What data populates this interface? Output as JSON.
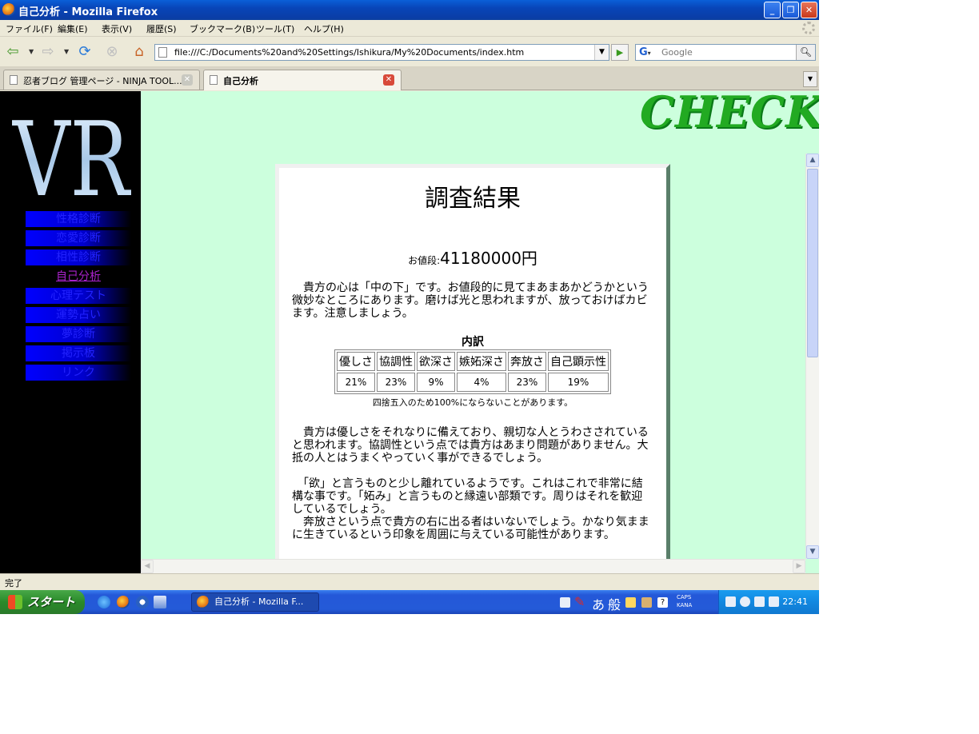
{
  "window": {
    "title": "自己分析 - Mozilla Firefox"
  },
  "menu": {
    "items": [
      {
        "label": "ファイル(F)"
      },
      {
        "label": "編集(E)"
      },
      {
        "label": "表示(V)"
      },
      {
        "label": "履歴(S)"
      },
      {
        "label": "ブックマーク(B)"
      },
      {
        "label": "ツール(T)"
      },
      {
        "label": "ヘルプ(H)"
      }
    ]
  },
  "nav": {
    "url": "file:///C:/Documents%20and%20Settings/Ishikura/My%20Documents/index.htm",
    "search_placeholder": "Google",
    "search_engine_icon": "G"
  },
  "tabs": [
    {
      "label": "忍者ブログ 管理ページ - NINJA TOOL...",
      "active": false
    },
    {
      "label": "自己分析",
      "active": true
    }
  ],
  "sidebar": {
    "logo_text": "VR",
    "items": [
      {
        "label": "性格診断"
      },
      {
        "label": "恋愛診断"
      },
      {
        "label": "相性診断"
      },
      {
        "label": "自己分析",
        "current": true
      },
      {
        "label": "心理テスト"
      },
      {
        "label": "運勢占い"
      },
      {
        "label": "夢診断"
      },
      {
        "label": "掲示板"
      },
      {
        "label": "リンク"
      }
    ]
  },
  "header": {
    "check_logo": "CHECK"
  },
  "result": {
    "title": "調査結果",
    "price_label": "お値段:",
    "price_value": "41180000円",
    "summary": "　貴方の心は「中の下」です。お値段的に見てまあまあかどうかという微妙なところにあります。磨けば光と思われますが、放っておけばカビます。注意しましょう。",
    "breakdown_title": "内訳",
    "breakdown": {
      "headers": [
        "優しさ",
        "協調性",
        "欲深さ",
        "嫉妬深さ",
        "奔放さ",
        "自己顕示性"
      ],
      "values": [
        "21%",
        "23%",
        "9%",
        "4%",
        "23%",
        "19%"
      ]
    },
    "note": "四捨五入のため100%にならないことがあります。",
    "para2": "　貴方は優しさをそれなりに備えており、親切な人とうわさされていると思われます。協調性という点では貴方はあまり問題がありません。大抵の人とはうまくやっていく事ができるでしょう。",
    "para3": "　「欲」と言うものと少し離れているようです。これはこれで非常に結構な事です。「妬み」と言うものと縁遠い部類です。周りはそれを歓迎しているでしょう。",
    "para4": "　奔放さという点で貴方の右に出る者はいないでしょう。かなり気ままに生きているという印象を周囲に与えている可能性があります。"
  },
  "status": {
    "text": "完了"
  },
  "taskbar": {
    "start_label": "スタート",
    "task_label": "自己分析 - Mozilla F...",
    "ime_a": "あ",
    "ime_mode": "般",
    "caps": "CAPS",
    "kana": "KANA",
    "clock": "22:41"
  },
  "colors": {
    "content_bg": "#ccffdd",
    "check_logo": "#22aa22",
    "sidebar_bg": "#000000",
    "nav_item": "#0000ff"
  }
}
